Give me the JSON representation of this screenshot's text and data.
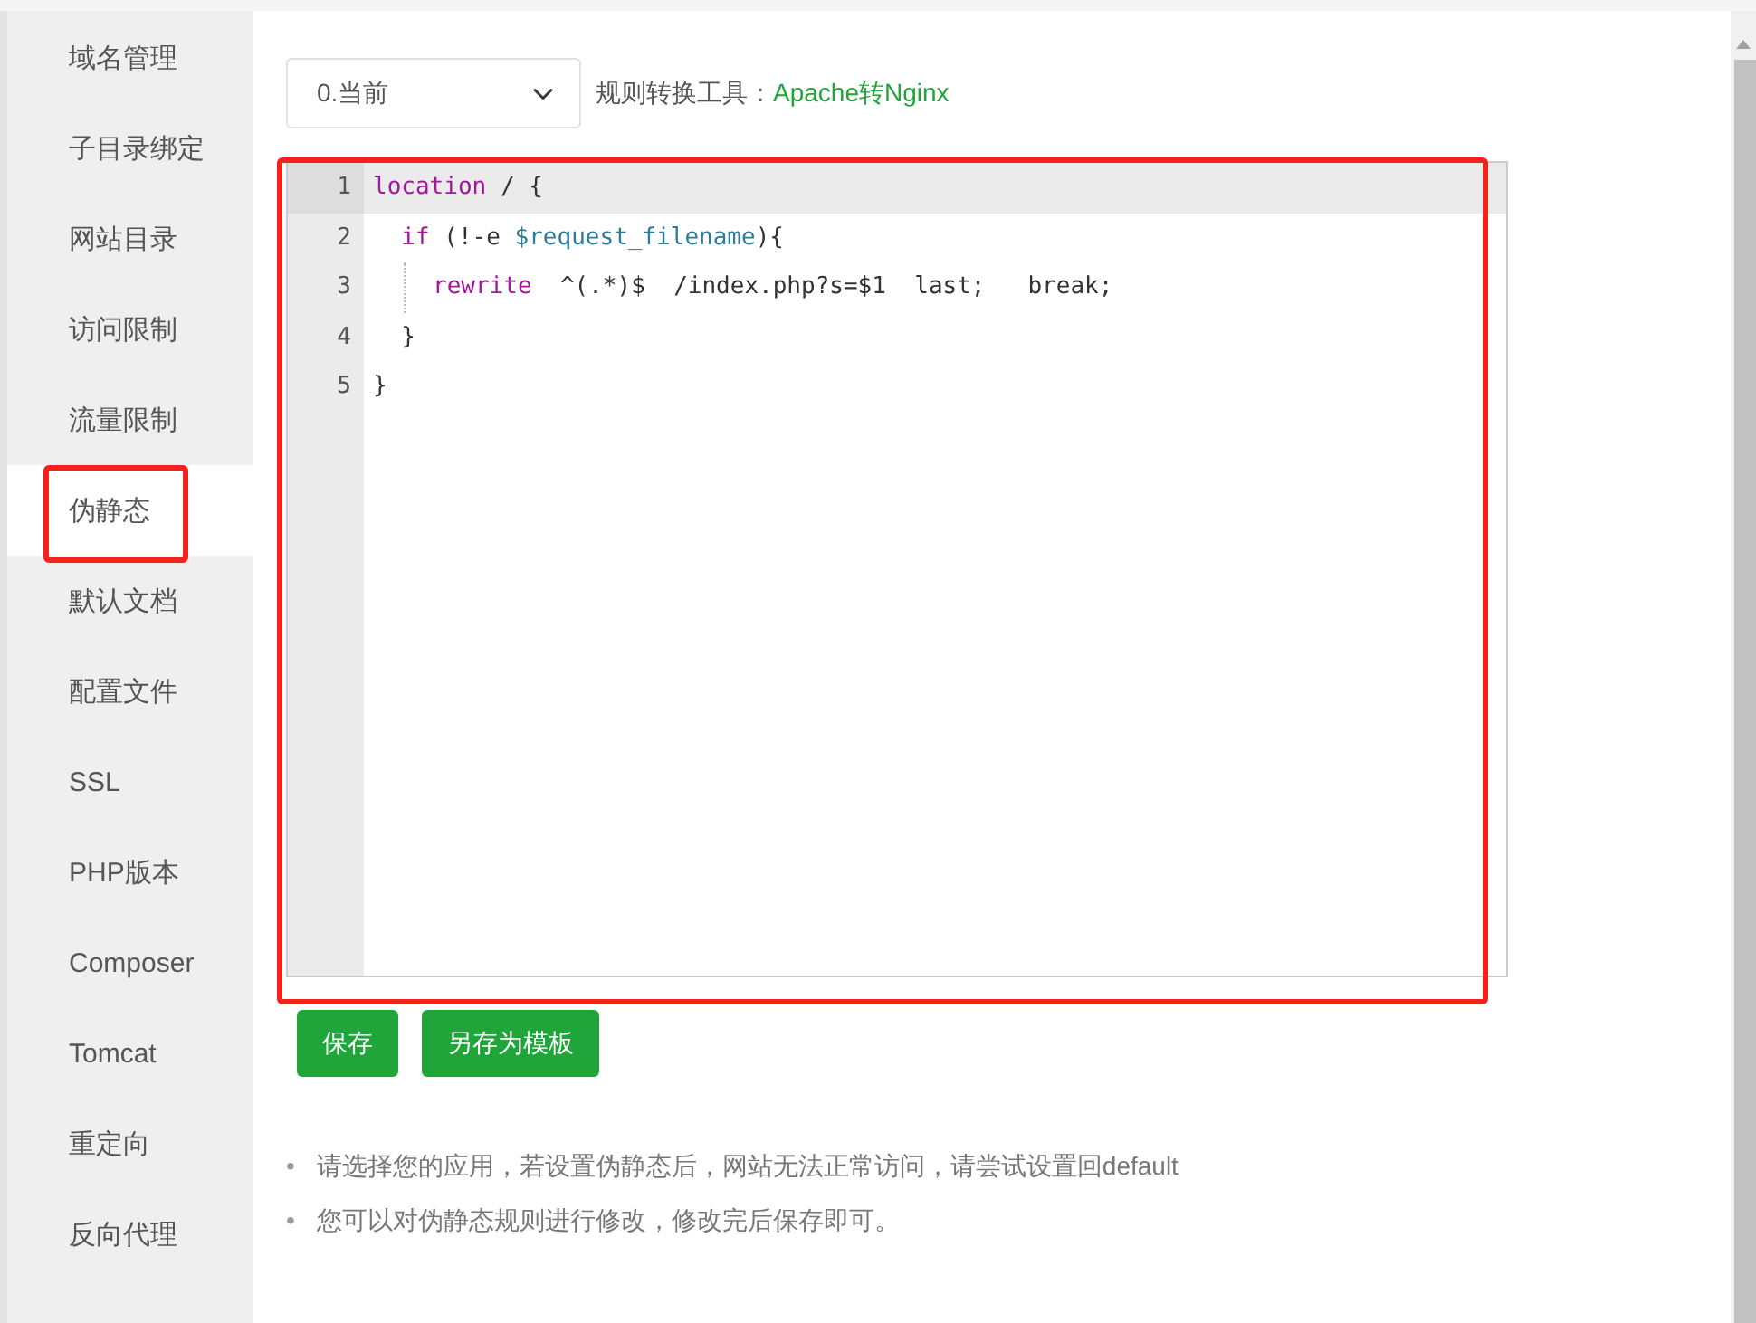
{
  "sidebar": {
    "items": [
      {
        "label": "域名管理",
        "selected": false,
        "highlighted": false
      },
      {
        "label": "子目录绑定",
        "selected": false,
        "highlighted": false
      },
      {
        "label": "网站目录",
        "selected": false,
        "highlighted": false
      },
      {
        "label": "访问限制",
        "selected": false,
        "highlighted": false
      },
      {
        "label": "流量限制",
        "selected": false,
        "highlighted": false
      },
      {
        "label": "伪静态",
        "selected": true,
        "highlighted": true
      },
      {
        "label": "默认文档",
        "selected": false,
        "highlighted": false
      },
      {
        "label": "配置文件",
        "selected": false,
        "highlighted": false
      },
      {
        "label": "SSL",
        "selected": false,
        "highlighted": false
      },
      {
        "label": "PHP版本",
        "selected": false,
        "highlighted": false
      },
      {
        "label": "Composer",
        "selected": false,
        "highlighted": false
      },
      {
        "label": "Tomcat",
        "selected": false,
        "highlighted": false
      },
      {
        "label": "重定向",
        "selected": false,
        "highlighted": false
      },
      {
        "label": "反向代理",
        "selected": false,
        "highlighted": false
      }
    ]
  },
  "toolbar": {
    "select_value": "0.当前",
    "tool_label": "规则转换工具：",
    "tool_link": "Apache转Nginx"
  },
  "editor": {
    "highlighted": true,
    "lines": [
      {
        "number": "1",
        "active": true,
        "tokens": [
          {
            "text": "location",
            "kind": "keyword"
          },
          {
            "text": " / {",
            "kind": "plain"
          }
        ]
      },
      {
        "number": "2",
        "active": false,
        "tokens": [
          {
            "text": "  if",
            "kind": "keyword"
          },
          {
            "text": " (!-e ",
            "kind": "plain"
          },
          {
            "text": "$request_filename",
            "kind": "variable"
          },
          {
            "text": "){",
            "kind": "plain"
          }
        ]
      },
      {
        "number": "3",
        "active": false,
        "guide": true,
        "tokens": [
          {
            "text": "rewrite",
            "kind": "keyword"
          },
          {
            "text": "  ^(.*)$  /index.php?s=$1  last;   break;",
            "kind": "plain"
          }
        ]
      },
      {
        "number": "4",
        "active": false,
        "tokens": [
          {
            "text": "  }",
            "kind": "plain"
          }
        ]
      },
      {
        "number": "5",
        "active": false,
        "tokens": [
          {
            "text": "}",
            "kind": "plain"
          }
        ]
      }
    ]
  },
  "buttons": [
    "保存",
    "另存为模板"
  ],
  "notes": [
    {
      "marker": "•",
      "text": "请选择您的应用，若设置伪静态后，网站无法正常访问，请尝试设置回default"
    },
    {
      "marker": "•",
      "text": "您可以对伪静态规则进行修改，修改完后保存即可。"
    }
  ]
}
